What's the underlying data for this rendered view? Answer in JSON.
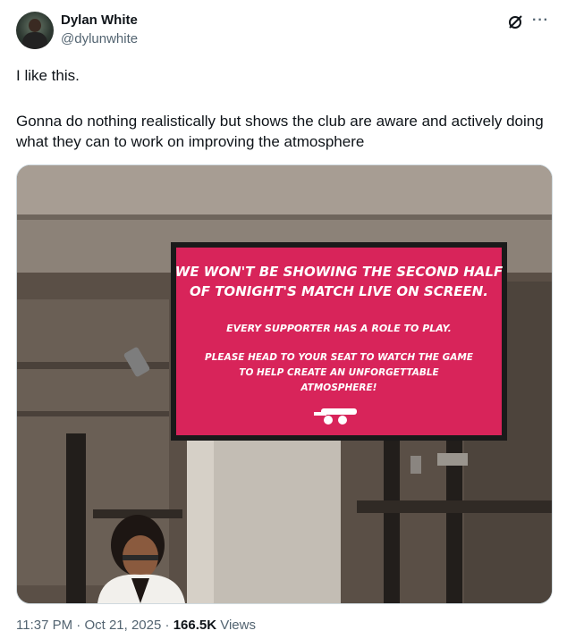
{
  "author": {
    "name": "Dylan White",
    "handle": "@dylunwhite"
  },
  "header_icons": [
    "grok-icon",
    "more-icon"
  ],
  "more_label": "···",
  "tweet": {
    "line1": "I like this.",
    "line2": "Gonna do nothing realistically but shows the club are aware and actively doing what they can to work on improving the atmosphere"
  },
  "photo": {
    "sign_lines": [
      "WE WON'T BE SHOWING THE SECOND HALF",
      "OF TONIGHT'S MATCH LIVE ON SCREEN.",
      "EVERY SUPPORTER HAS A ROLE TO PLAY.",
      "PLEASE HEAD TO YOUR SEAT TO WATCH THE GAME",
      "TO HELP CREATE AN UNFORGETTABLE",
      "ATMOSPHERE!"
    ],
    "sign_color": "#d8245a"
  },
  "meta": {
    "time": "11:37 PM",
    "sep1": " · ",
    "date": "Oct 21, 2025",
    "sep2": " · ",
    "views_count": "166.5K",
    "views_label": " Views"
  }
}
